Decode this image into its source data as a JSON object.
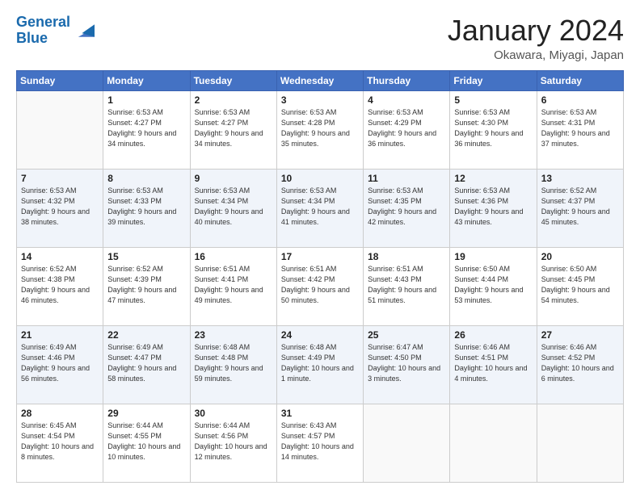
{
  "header": {
    "logo_line1": "General",
    "logo_line2": "Blue",
    "month": "January 2024",
    "location": "Okawara, Miyagi, Japan"
  },
  "days": [
    "Sunday",
    "Monday",
    "Tuesday",
    "Wednesday",
    "Thursday",
    "Friday",
    "Saturday"
  ],
  "weeks": [
    [
      {
        "date": "",
        "sunrise": "",
        "sunset": "",
        "daylight": ""
      },
      {
        "date": "1",
        "sunrise": "Sunrise: 6:53 AM",
        "sunset": "Sunset: 4:27 PM",
        "daylight": "Daylight: 9 hours and 34 minutes."
      },
      {
        "date": "2",
        "sunrise": "Sunrise: 6:53 AM",
        "sunset": "Sunset: 4:27 PM",
        "daylight": "Daylight: 9 hours and 34 minutes."
      },
      {
        "date": "3",
        "sunrise": "Sunrise: 6:53 AM",
        "sunset": "Sunset: 4:28 PM",
        "daylight": "Daylight: 9 hours and 35 minutes."
      },
      {
        "date": "4",
        "sunrise": "Sunrise: 6:53 AM",
        "sunset": "Sunset: 4:29 PM",
        "daylight": "Daylight: 9 hours and 36 minutes."
      },
      {
        "date": "5",
        "sunrise": "Sunrise: 6:53 AM",
        "sunset": "Sunset: 4:30 PM",
        "daylight": "Daylight: 9 hours and 36 minutes."
      },
      {
        "date": "6",
        "sunrise": "Sunrise: 6:53 AM",
        "sunset": "Sunset: 4:31 PM",
        "daylight": "Daylight: 9 hours and 37 minutes."
      }
    ],
    [
      {
        "date": "7",
        "sunrise": "Sunrise: 6:53 AM",
        "sunset": "Sunset: 4:32 PM",
        "daylight": "Daylight: 9 hours and 38 minutes."
      },
      {
        "date": "8",
        "sunrise": "Sunrise: 6:53 AM",
        "sunset": "Sunset: 4:33 PM",
        "daylight": "Daylight: 9 hours and 39 minutes."
      },
      {
        "date": "9",
        "sunrise": "Sunrise: 6:53 AM",
        "sunset": "Sunset: 4:34 PM",
        "daylight": "Daylight: 9 hours and 40 minutes."
      },
      {
        "date": "10",
        "sunrise": "Sunrise: 6:53 AM",
        "sunset": "Sunset: 4:34 PM",
        "daylight": "Daylight: 9 hours and 41 minutes."
      },
      {
        "date": "11",
        "sunrise": "Sunrise: 6:53 AM",
        "sunset": "Sunset: 4:35 PM",
        "daylight": "Daylight: 9 hours and 42 minutes."
      },
      {
        "date": "12",
        "sunrise": "Sunrise: 6:53 AM",
        "sunset": "Sunset: 4:36 PM",
        "daylight": "Daylight: 9 hours and 43 minutes."
      },
      {
        "date": "13",
        "sunrise": "Sunrise: 6:52 AM",
        "sunset": "Sunset: 4:37 PM",
        "daylight": "Daylight: 9 hours and 45 minutes."
      }
    ],
    [
      {
        "date": "14",
        "sunrise": "Sunrise: 6:52 AM",
        "sunset": "Sunset: 4:38 PM",
        "daylight": "Daylight: 9 hours and 46 minutes."
      },
      {
        "date": "15",
        "sunrise": "Sunrise: 6:52 AM",
        "sunset": "Sunset: 4:39 PM",
        "daylight": "Daylight: 9 hours and 47 minutes."
      },
      {
        "date": "16",
        "sunrise": "Sunrise: 6:51 AM",
        "sunset": "Sunset: 4:41 PM",
        "daylight": "Daylight: 9 hours and 49 minutes."
      },
      {
        "date": "17",
        "sunrise": "Sunrise: 6:51 AM",
        "sunset": "Sunset: 4:42 PM",
        "daylight": "Daylight: 9 hours and 50 minutes."
      },
      {
        "date": "18",
        "sunrise": "Sunrise: 6:51 AM",
        "sunset": "Sunset: 4:43 PM",
        "daylight": "Daylight: 9 hours and 51 minutes."
      },
      {
        "date": "19",
        "sunrise": "Sunrise: 6:50 AM",
        "sunset": "Sunset: 4:44 PM",
        "daylight": "Daylight: 9 hours and 53 minutes."
      },
      {
        "date": "20",
        "sunrise": "Sunrise: 6:50 AM",
        "sunset": "Sunset: 4:45 PM",
        "daylight": "Daylight: 9 hours and 54 minutes."
      }
    ],
    [
      {
        "date": "21",
        "sunrise": "Sunrise: 6:49 AM",
        "sunset": "Sunset: 4:46 PM",
        "daylight": "Daylight: 9 hours and 56 minutes."
      },
      {
        "date": "22",
        "sunrise": "Sunrise: 6:49 AM",
        "sunset": "Sunset: 4:47 PM",
        "daylight": "Daylight: 9 hours and 58 minutes."
      },
      {
        "date": "23",
        "sunrise": "Sunrise: 6:48 AM",
        "sunset": "Sunset: 4:48 PM",
        "daylight": "Daylight: 9 hours and 59 minutes."
      },
      {
        "date": "24",
        "sunrise": "Sunrise: 6:48 AM",
        "sunset": "Sunset: 4:49 PM",
        "daylight": "Daylight: 10 hours and 1 minute."
      },
      {
        "date": "25",
        "sunrise": "Sunrise: 6:47 AM",
        "sunset": "Sunset: 4:50 PM",
        "daylight": "Daylight: 10 hours and 3 minutes."
      },
      {
        "date": "26",
        "sunrise": "Sunrise: 6:46 AM",
        "sunset": "Sunset: 4:51 PM",
        "daylight": "Daylight: 10 hours and 4 minutes."
      },
      {
        "date": "27",
        "sunrise": "Sunrise: 6:46 AM",
        "sunset": "Sunset: 4:52 PM",
        "daylight": "Daylight: 10 hours and 6 minutes."
      }
    ],
    [
      {
        "date": "28",
        "sunrise": "Sunrise: 6:45 AM",
        "sunset": "Sunset: 4:54 PM",
        "daylight": "Daylight: 10 hours and 8 minutes."
      },
      {
        "date": "29",
        "sunrise": "Sunrise: 6:44 AM",
        "sunset": "Sunset: 4:55 PM",
        "daylight": "Daylight: 10 hours and 10 minutes."
      },
      {
        "date": "30",
        "sunrise": "Sunrise: 6:44 AM",
        "sunset": "Sunset: 4:56 PM",
        "daylight": "Daylight: 10 hours and 12 minutes."
      },
      {
        "date": "31",
        "sunrise": "Sunrise: 6:43 AM",
        "sunset": "Sunset: 4:57 PM",
        "daylight": "Daylight: 10 hours and 14 minutes."
      },
      {
        "date": "",
        "sunrise": "",
        "sunset": "",
        "daylight": ""
      },
      {
        "date": "",
        "sunrise": "",
        "sunset": "",
        "daylight": ""
      },
      {
        "date": "",
        "sunrise": "",
        "sunset": "",
        "daylight": ""
      }
    ]
  ]
}
